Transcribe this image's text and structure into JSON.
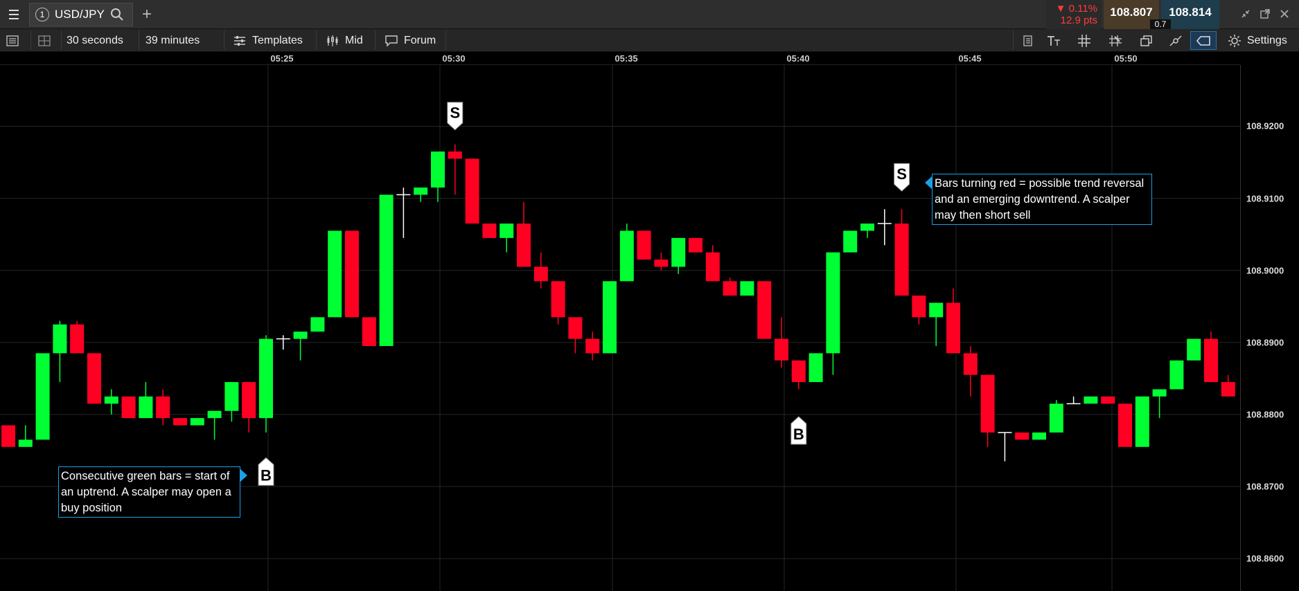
{
  "toolbar": {
    "symbol_number": "1",
    "symbol": "USD/JPY",
    "change_pct": "▼ 0.11%",
    "change_pts": "12.9 pts",
    "sell_price": "108.807",
    "buy_price": "108.814",
    "spread": "0.7"
  },
  "toolbar2": {
    "interval": "30 seconds",
    "duration": "39 minutes",
    "templates_label": "Templates",
    "price_type": "Mid",
    "forum_label": "Forum",
    "settings_label": "Settings"
  },
  "chart_data": {
    "type": "candlestick",
    "time_ticks": [
      "05:25",
      "05:30",
      "05:35",
      "05:40",
      "05:45",
      "05:50"
    ],
    "price_ticks": [
      "108.9200",
      "108.9100",
      "108.9000",
      "108.8900",
      "108.8800",
      "108.8700",
      "108.8600"
    ],
    "price_tick_values": [
      108.92,
      108.91,
      108.9,
      108.89,
      108.88,
      108.87,
      108.86
    ],
    "ylim": [
      108.8555,
      108.9285
    ],
    "grid": true,
    "colors": {
      "up": "#00ff33",
      "down": "#ff0022",
      "doji": "#ffffff",
      "grid": "#262626"
    },
    "candles": [
      {
        "o": 108.8785,
        "h": 108.8785,
        "l": 108.8755,
        "c": 108.8755
      },
      {
        "o": 108.8755,
        "h": 108.8785,
        "l": 108.8755,
        "c": 108.8765
      },
      {
        "o": 108.8765,
        "h": 108.8885,
        "l": 108.8765,
        "c": 108.8885
      },
      {
        "o": 108.8885,
        "h": 108.893,
        "l": 108.8845,
        "c": 108.8925
      },
      {
        "o": 108.8925,
        "h": 108.893,
        "l": 108.8885,
        "c": 108.8885
      },
      {
        "o": 108.8885,
        "h": 108.8885,
        "l": 108.8815,
        "c": 108.8815
      },
      {
        "o": 108.8815,
        "h": 108.8835,
        "l": 108.88,
        "c": 108.8825
      },
      {
        "o": 108.8825,
        "h": 108.8825,
        "l": 108.8795,
        "c": 108.8795
      },
      {
        "o": 108.8795,
        "h": 108.8845,
        "l": 108.8795,
        "c": 108.8825
      },
      {
        "o": 108.8825,
        "h": 108.8835,
        "l": 108.8785,
        "c": 108.8795
      },
      {
        "o": 108.8795,
        "h": 108.8795,
        "l": 108.8785,
        "c": 108.8785
      },
      {
        "o": 108.8785,
        "h": 108.8795,
        "l": 108.8785,
        "c": 108.8795
      },
      {
        "o": 108.8795,
        "h": 108.8805,
        "l": 108.8765,
        "c": 108.8805
      },
      {
        "o": 108.8805,
        "h": 108.8845,
        "l": 108.879,
        "c": 108.8845
      },
      {
        "o": 108.8845,
        "h": 108.8845,
        "l": 108.8775,
        "c": 108.8795
      },
      {
        "o": 108.8795,
        "h": 108.891,
        "l": 108.8775,
        "c": 108.8905
      },
      {
        "o": 108.8905,
        "h": 108.891,
        "l": 108.889,
        "c": 108.8905
      },
      {
        "o": 108.8905,
        "h": 108.8915,
        "l": 108.8875,
        "c": 108.8915
      },
      {
        "o": 108.8915,
        "h": 108.8935,
        "l": 108.8915,
        "c": 108.8935
      },
      {
        "o": 108.8935,
        "h": 108.9055,
        "l": 108.8935,
        "c": 108.9055
      },
      {
        "o": 108.9055,
        "h": 108.9055,
        "l": 108.8935,
        "c": 108.8935
      },
      {
        "o": 108.8935,
        "h": 108.8935,
        "l": 108.8895,
        "c": 108.8895
      },
      {
        "o": 108.8895,
        "h": 108.9105,
        "l": 108.8895,
        "c": 108.9105
      },
      {
        "o": 108.9105,
        "h": 108.9115,
        "l": 108.9045,
        "c": 108.9105
      },
      {
        "o": 108.9105,
        "h": 108.911,
        "l": 108.9095,
        "c": 108.9115
      },
      {
        "o": 108.9115,
        "h": 108.9165,
        "l": 108.9095,
        "c": 108.9165
      },
      {
        "o": 108.9165,
        "h": 108.9175,
        "l": 108.9105,
        "c": 108.9155
      },
      {
        "o": 108.9155,
        "h": 108.9155,
        "l": 108.9065,
        "c": 108.9065
      },
      {
        "o": 108.9065,
        "h": 108.9065,
        "l": 108.9045,
        "c": 108.9045
      },
      {
        "o": 108.9045,
        "h": 108.9065,
        "l": 108.9025,
        "c": 108.9065
      },
      {
        "o": 108.9065,
        "h": 108.9095,
        "l": 108.9005,
        "c": 108.9005
      },
      {
        "o": 108.9005,
        "h": 108.9025,
        "l": 108.8975,
        "c": 108.8985
      },
      {
        "o": 108.8985,
        "h": 108.8985,
        "l": 108.8925,
        "c": 108.8935
      },
      {
        "o": 108.8935,
        "h": 108.8935,
        "l": 108.8885,
        "c": 108.8905
      },
      {
        "o": 108.8905,
        "h": 108.8915,
        "l": 108.8875,
        "c": 108.8885
      },
      {
        "o": 108.8885,
        "h": 108.8985,
        "l": 108.8885,
        "c": 108.8985
      },
      {
        "o": 108.8985,
        "h": 108.9065,
        "l": 108.8985,
        "c": 108.9055
      },
      {
        "o": 108.9055,
        "h": 108.9055,
        "l": 108.9015,
        "c": 108.9015
      },
      {
        "o": 108.9015,
        "h": 108.9025,
        "l": 108.9,
        "c": 108.9005
      },
      {
        "o": 108.9005,
        "h": 108.9045,
        "l": 108.8995,
        "c": 108.9045
      },
      {
        "o": 108.9045,
        "h": 108.9045,
        "l": 108.9025,
        "c": 108.9025
      },
      {
        "o": 108.9025,
        "h": 108.9035,
        "l": 108.8985,
        "c": 108.8985
      },
      {
        "o": 108.8985,
        "h": 108.899,
        "l": 108.8965,
        "c": 108.8965
      },
      {
        "o": 108.8965,
        "h": 108.8985,
        "l": 108.8965,
        "c": 108.8985
      },
      {
        "o": 108.8985,
        "h": 108.8985,
        "l": 108.8905,
        "c": 108.8905
      },
      {
        "o": 108.8905,
        "h": 108.8935,
        "l": 108.8865,
        "c": 108.8875
      },
      {
        "o": 108.8875,
        "h": 108.8875,
        "l": 108.8835,
        "c": 108.8845
      },
      {
        "o": 108.8845,
        "h": 108.8885,
        "l": 108.8845,
        "c": 108.8885
      },
      {
        "o": 108.8885,
        "h": 108.9025,
        "l": 108.8855,
        "c": 108.9025
      },
      {
        "o": 108.9025,
        "h": 108.9055,
        "l": 108.9025,
        "c": 108.9055
      },
      {
        "o": 108.9055,
        "h": 108.9065,
        "l": 108.9045,
        "c": 108.9065
      },
      {
        "o": 108.9065,
        "h": 108.9085,
        "l": 108.9035,
        "c": 108.9065
      },
      {
        "o": 108.9065,
        "h": 108.9085,
        "l": 108.8965,
        "c": 108.8965
      },
      {
        "o": 108.8965,
        "h": 108.8965,
        "l": 108.8925,
        "c": 108.8935
      },
      {
        "o": 108.8935,
        "h": 108.8955,
        "l": 108.8895,
        "c": 108.8955
      },
      {
        "o": 108.8955,
        "h": 108.8975,
        "l": 108.8885,
        "c": 108.8885
      },
      {
        "o": 108.8885,
        "h": 108.8895,
        "l": 108.8825,
        "c": 108.8855
      },
      {
        "o": 108.8855,
        "h": 108.8855,
        "l": 108.8755,
        "c": 108.8775
      },
      {
        "o": 108.8775,
        "h": 108.8775,
        "l": 108.8735,
        "c": 108.8775
      },
      {
        "o": 108.8775,
        "h": 108.8775,
        "l": 108.8765,
        "c": 108.8765
      },
      {
        "o": 108.8765,
        "h": 108.8775,
        "l": 108.8765,
        "c": 108.8775
      },
      {
        "o": 108.8775,
        "h": 108.882,
        "l": 108.8775,
        "c": 108.8815
      },
      {
        "o": 108.8815,
        "h": 108.8825,
        "l": 108.8815,
        "c": 108.8815
      },
      {
        "o": 108.8815,
        "h": 108.8825,
        "l": 108.8815,
        "c": 108.8825
      },
      {
        "o": 108.8825,
        "h": 108.8825,
        "l": 108.8815,
        "c": 108.8815
      },
      {
        "o": 108.8815,
        "h": 108.8815,
        "l": 108.8755,
        "c": 108.8755
      },
      {
        "o": 108.8755,
        "h": 108.8825,
        "l": 108.8755,
        "c": 108.8825
      },
      {
        "o": 108.8825,
        "h": 108.8835,
        "l": 108.8795,
        "c": 108.8835
      },
      {
        "o": 108.8835,
        "h": 108.8875,
        "l": 108.8835,
        "c": 108.8875
      },
      {
        "o": 108.8875,
        "h": 108.8905,
        "l": 108.8875,
        "c": 108.8905
      },
      {
        "o": 108.8905,
        "h": 108.8915,
        "l": 108.8845,
        "c": 108.8845
      },
      {
        "o": 108.8845,
        "h": 108.8855,
        "l": 108.8825,
        "c": 108.8825
      }
    ],
    "signals": [
      {
        "type": "B",
        "candle_index": 15,
        "price": 108.874
      },
      {
        "type": "S",
        "candle_index": 26,
        "price": 108.9195
      },
      {
        "type": "B",
        "candle_index": 46,
        "price": 108.8797
      },
      {
        "type": "S",
        "candle_index": 52,
        "price": 108.911
      }
    ],
    "annotations": [
      "Consecutive green bars = start of an uptrend. A scalper may open a buy position",
      "Bars turning red = possible trend reversal and an emerging downtrend. A scalper may then short sell"
    ]
  }
}
